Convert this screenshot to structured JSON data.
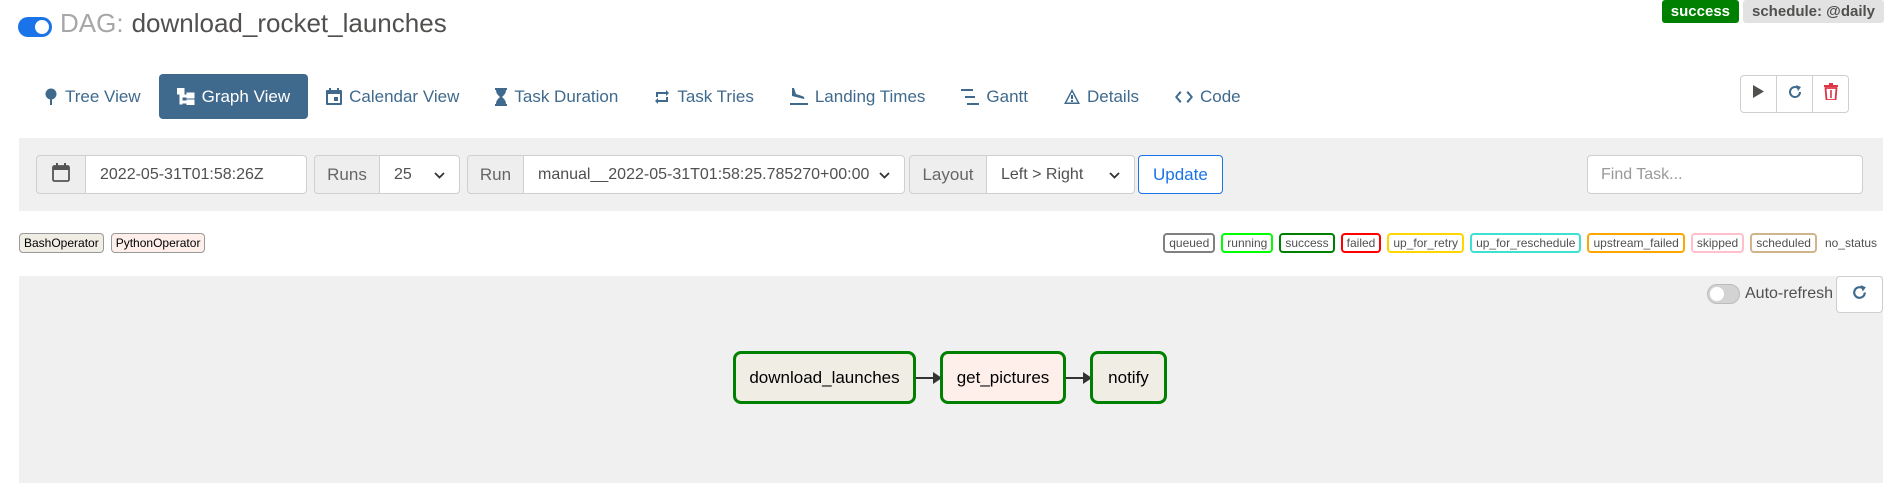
{
  "header": {
    "dag_prefix": "DAG:",
    "dag_name": "download_rocket_launches",
    "status_badge": "success",
    "schedule_badge": "schedule: @daily"
  },
  "nav": {
    "tabs": [
      {
        "label": "Tree View",
        "icon": "pin-icon"
      },
      {
        "label": "Graph View",
        "icon": "graph-icon",
        "active": true
      },
      {
        "label": "Calendar View",
        "icon": "calendar-icon"
      },
      {
        "label": "Task Duration",
        "icon": "hourglass-icon"
      },
      {
        "label": "Task Tries",
        "icon": "retry-arrows-icon"
      },
      {
        "label": "Landing Times",
        "icon": "plane-landing-icon"
      },
      {
        "label": "Gantt",
        "icon": "gantt-icon"
      },
      {
        "label": "Details",
        "icon": "warning-triangle-icon"
      },
      {
        "label": "Code",
        "icon": "code-icon"
      }
    ],
    "actions": [
      "trigger-icon",
      "refresh-icon",
      "delete-icon"
    ]
  },
  "filter_bar": {
    "base_date": "2022-05-31T01:58:26Z",
    "runs_label": "Runs",
    "runs_value": "25",
    "run_label": "Run",
    "run_value": "manual__2022-05-31T01:58:25.785270+00:00",
    "layout_label": "Layout",
    "layout_value": "Left > Right",
    "update_label": "Update",
    "find_task_placeholder": "Find Task..."
  },
  "operator_legend": [
    {
      "label": "BashOperator",
      "color": "#f0ede4"
    },
    {
      "label": "PythonOperator",
      "color": "#ffefeb"
    }
  ],
  "state_legend": [
    {
      "label": "queued",
      "color": "#808080"
    },
    {
      "label": "running",
      "color": "#00ff00"
    },
    {
      "label": "success",
      "color": "#008000"
    },
    {
      "label": "failed",
      "color": "#ff0000"
    },
    {
      "label": "up_for_retry",
      "color": "#ffd700"
    },
    {
      "label": "up_for_reschedule",
      "color": "#40e0d0"
    },
    {
      "label": "upstream_failed",
      "color": "#ffa500"
    },
    {
      "label": "skipped",
      "color": "#ffc0cb"
    },
    {
      "label": "scheduled",
      "color": "#d2b48c"
    },
    {
      "label": "no_status",
      "color": null
    }
  ],
  "graph": {
    "autorefresh_label": "Auto-refresh",
    "nodes": [
      {
        "label": "download_launches",
        "state": "success",
        "operator": "BashOperator"
      },
      {
        "label": "get_pictures",
        "state": "success",
        "operator": "PythonOperator"
      },
      {
        "label": "notify",
        "state": "success",
        "operator": "BashOperator"
      }
    ]
  }
}
